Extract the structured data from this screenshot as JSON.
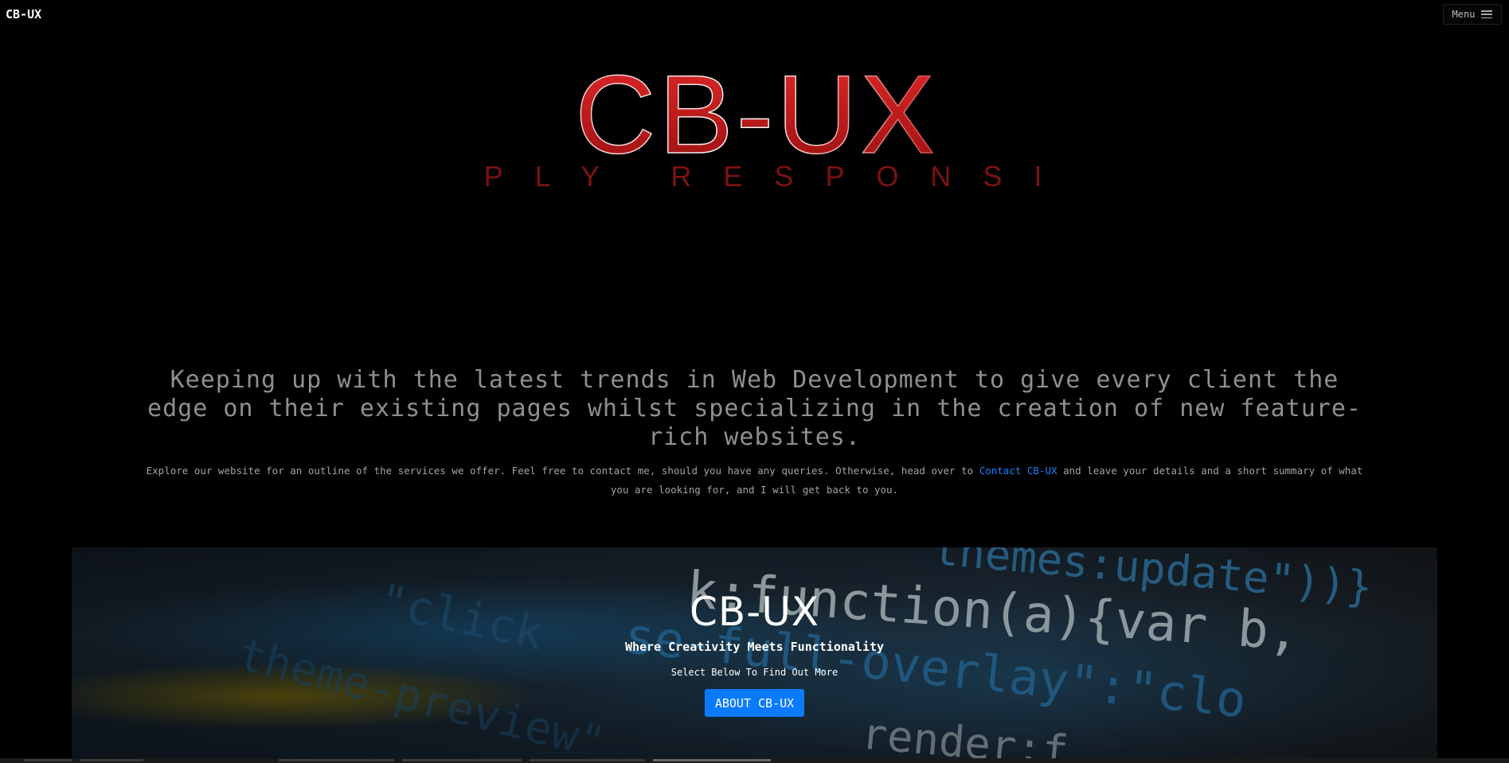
{
  "nav": {
    "brand": "CB-UX",
    "menu_label": "Menu"
  },
  "logo": {
    "wordmark": "CB-UX",
    "tagline": "SIMPLY RESPONSIVE"
  },
  "intro": {
    "headline": "Keeping up with the latest trends in Web Development to give every client the edge on their existing pages whilst specializing in the creation of new feature-rich websites.",
    "text_before_link": "Explore our website for an outline of the services we offer. Feel free to contact me, should you have any queries. Otherwise, head over to ",
    "link_text": "Contact CB-UX",
    "text_after_link": " and leave your details and a short summary of what you are looking for, and I will get back to you."
  },
  "hero": {
    "title": "CB-UX",
    "subtitle": "Where Creativity Meets Functionality",
    "prompt": "Select Below To Find Out More",
    "button_label": "ABOUT CB-UX",
    "background_code": [
      "themes:update\"))}",
      "k:function(a){var b,",
      "se-full-overlay\":\"clo",
      "\"click",
      "theme-preview\"",
      "render:f"
    ]
  },
  "colors": {
    "accent": "#0a7bff",
    "logo_red": "#d41f1f",
    "link": "#1a82ff"
  }
}
